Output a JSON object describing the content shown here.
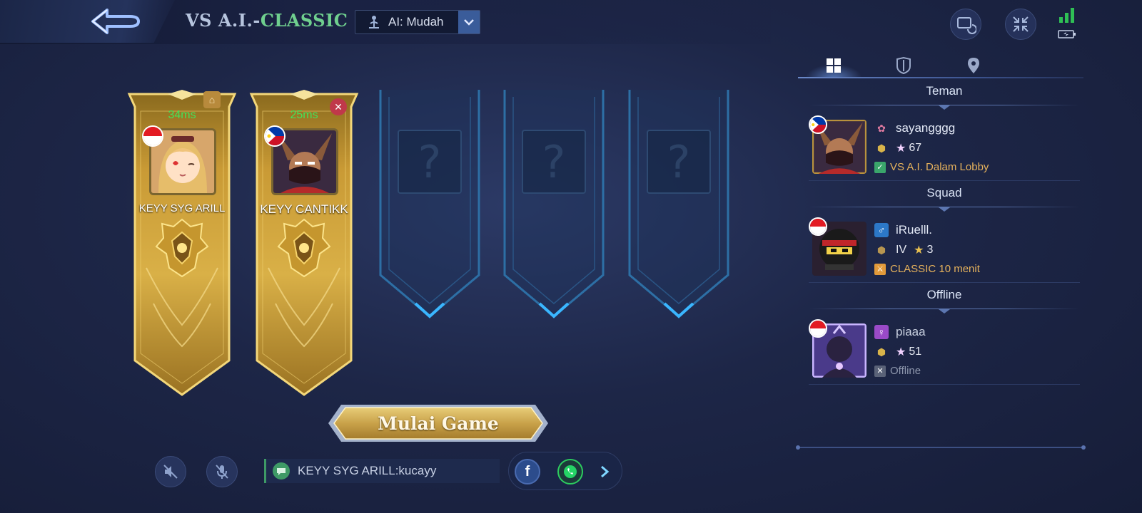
{
  "header": {
    "mode_prefix": "VS A.I.-",
    "mode_name": "CLASSIC",
    "ai_difficulty": "AI: Mudah",
    "icons": [
      "back-arrow-icon",
      "screen-refresh-icon",
      "collapse-icon",
      "signal-icon",
      "battery-icon"
    ]
  },
  "slots": [
    {
      "ping": "34ms",
      "name": "KEYY SYG ARILL",
      "flag": "ID",
      "corner": "home-icon"
    },
    {
      "ping": "25ms",
      "name": "KEYY CANTIKK",
      "flag": "PH",
      "corner": "close-icon"
    },
    {
      "empty": "?"
    },
    {
      "empty": "?"
    },
    {
      "empty": "?"
    }
  ],
  "start_button": {
    "label": "Mulai Game"
  },
  "bottom": {
    "chat_text": "KEYY SYG ARILL:kucayy",
    "icons": [
      "speaker-muted-icon",
      "mic-muted-icon",
      "facebook-icon",
      "whatsapp-icon",
      "chevron-right-icon"
    ]
  },
  "panel": {
    "tabs": [
      "grid-icon",
      "shield-icon",
      "location-pin-icon"
    ],
    "sections": [
      {
        "title": "Teman",
        "friend": {
          "name": "sayangggg",
          "stars": "67",
          "status": "VS A.I. Dalam Lobby",
          "flag": "PH",
          "status_color": "#e6b25c"
        }
      },
      {
        "title": "Squad",
        "friend": {
          "name": "iRuelll.",
          "rank": "IV",
          "stars": "3",
          "status": "CLASSIC 10 menit",
          "flag": "ID",
          "status_color": "#e6b25c"
        }
      },
      {
        "title": "Offline",
        "friend": {
          "name": "piaaa",
          "stars": "51",
          "status": "Offline",
          "flag": "ID",
          "status_color": "#8e97ad"
        }
      }
    ]
  },
  "colors": {
    "accent_green": "#6fcf8e",
    "gold": "#d9b44a",
    "ping": "#45e25a"
  }
}
